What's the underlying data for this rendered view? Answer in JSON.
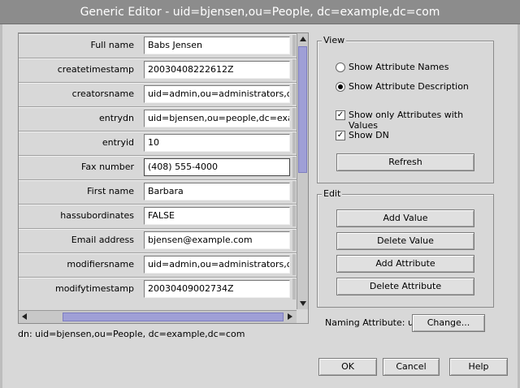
{
  "window": {
    "title": "Generic Editor - uid=bjensen,ou=People, dc=example,dc=com"
  },
  "attributes": [
    {
      "label": "Full name",
      "value": "Babs Jensen"
    },
    {
      "label": "createtimestamp",
      "value": "20030408222612Z"
    },
    {
      "label": "creatorsname",
      "value": "uid=admin,ou=administrators,ou=top"
    },
    {
      "label": "entrydn",
      "value": "uid=bjensen,ou=people,dc=example"
    },
    {
      "label": "entryid",
      "value": "10"
    },
    {
      "label": "Fax number",
      "value": "(408) 555-4000"
    },
    {
      "label": "First name",
      "value": "Barbara"
    },
    {
      "label": "hassubordinates",
      "value": "FALSE"
    },
    {
      "label": "Email address",
      "value": "bjensen@example.com"
    },
    {
      "label": "modifiersname",
      "value": "uid=admin,ou=administrators,ou=top"
    },
    {
      "label": "modifytimestamp",
      "value": "20030409002734Z"
    }
  ],
  "dn_text": "dn: uid=bjensen,ou=People, dc=example,dc=com",
  "view": {
    "title": "View",
    "show_names": "Show Attribute Names",
    "show_desc": "Show Attribute Description",
    "only_values": "Show only Attributes with Values",
    "show_dn": "Show DN",
    "refresh": "Refresh"
  },
  "edit": {
    "title": "Edit",
    "add_value": "Add Value",
    "delete_value": "Delete Value",
    "add_attribute": "Add Attribute",
    "delete_attribute": "Delete Attribute"
  },
  "naming": {
    "label": "Naming Attribute: uid",
    "change": "Change..."
  },
  "footer": {
    "ok": "OK",
    "cancel": "Cancel",
    "help": "Help"
  },
  "colors": {
    "titlebar": "#8c8c8c",
    "scroll_thumb": "#9f9fd6",
    "background": "#d8d8d8"
  },
  "state": {
    "view_mode": "description",
    "only_with_values": true,
    "show_dn": true
  }
}
